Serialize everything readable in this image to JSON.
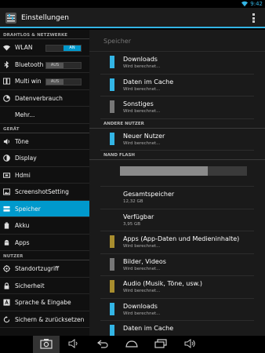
{
  "status": {
    "time": "9:42"
  },
  "app": {
    "title": "Einstellungen"
  },
  "left": {
    "sections": {
      "wireless": "DRAHTLOS & NETZWERKE",
      "device": "GERÄT",
      "users": "NUTZER"
    },
    "items": {
      "wlan": "WLAN",
      "bluetooth": "Bluetooth",
      "multiwin": "Multi win",
      "data": "Datenverbrauch",
      "more": "Mehr...",
      "sound": "Töne",
      "display": "Display",
      "hdmi": "Hdmi",
      "screenshot": "ScreenshotSetting",
      "storage": "Speicher",
      "battery": "Akku",
      "apps": "Apps",
      "location": "Standortzugriff",
      "security": "Sicherheit",
      "language": "Sprache & Eingabe",
      "backup": "Sichern & zurücksetzen"
    },
    "toggles": {
      "wlan": "AN",
      "bluetooth": "AUS",
      "multiwin": "AUS"
    }
  },
  "right": {
    "header": "Speicher",
    "sub_other_users": "ANDERE NUTZER",
    "sub_nand": "NAND FLASH",
    "nand_used_fraction": 0.69,
    "rows_top": [
      {
        "title": "Downloads",
        "sub": "Wird berechnet...",
        "color": "#33b5e5"
      },
      {
        "title": "Daten im Cache",
        "sub": "Wird berechnet...",
        "color": "#33b5e5"
      },
      {
        "title": "Sonstiges",
        "sub": "Wird berechnet...",
        "color": "#777777"
      }
    ],
    "row_user": {
      "title": "Neuer Nutzer",
      "sub": "Wird berechnet...",
      "color": "#33b5e5"
    },
    "rows_nand": [
      {
        "title": "Gesamtspeicher",
        "sub": "12,32 GB",
        "color": ""
      },
      {
        "title": "Verfügbar",
        "sub": "3,95 GB",
        "color": ""
      },
      {
        "title": "Apps (App-Daten und Medieninhalte)",
        "sub": "Wird berechnet...",
        "color": "#a88d2e"
      },
      {
        "title": "Bilder, Videos",
        "sub": "Wird berechnet...",
        "color": "#777777"
      },
      {
        "title": "Audio (Musik, Töne, usw.)",
        "sub": "Wird berechnet...",
        "color": "#a88d2e"
      },
      {
        "title": "Downloads",
        "sub": "Wird berechnet...",
        "color": "#33b5e5"
      },
      {
        "title": "Daten im Cache",
        "sub": "",
        "color": "#33b5e5"
      }
    ]
  }
}
